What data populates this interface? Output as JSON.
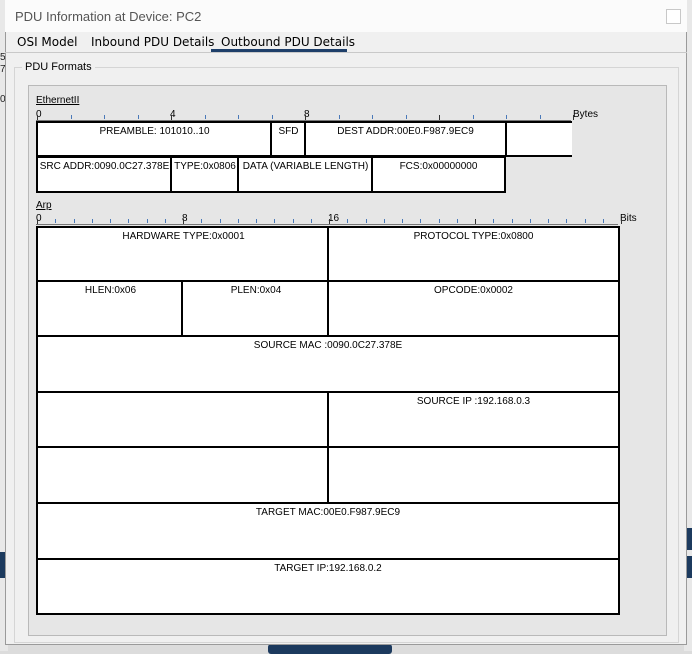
{
  "window": {
    "title": "PDU Information at Device: PC2"
  },
  "tabs": [
    {
      "label": "OSI Model"
    },
    {
      "label": "Inbound PDU Details"
    },
    {
      "label": "Outbound PDU Details"
    }
  ],
  "group": {
    "legend": "PDU Formats"
  },
  "background": {
    "edge_marks": [
      "5.",
      "7",
      "0"
    ]
  },
  "ethernet": {
    "label": "EthernetII",
    "ruler_numbers": [
      "0",
      "4",
      "8"
    ],
    "unit": "Bytes",
    "fields": {
      "preamble": "PREAMBLE: 101010..10",
      "sfd": "SFD",
      "dest": "DEST ADDR:00E0.F987.9EC9",
      "extra": "",
      "src": "SRC ADDR:0090.0C27.378E",
      "type": "TYPE:0x0806",
      "data": "DATA (VARIABLE LENGTH)",
      "fcs": "FCS:0x00000000"
    }
  },
  "arp": {
    "label": "Arp",
    "ruler_numbers": [
      "0",
      "8",
      "16"
    ],
    "unit": "Bits",
    "fields": {
      "hw_type": "HARDWARE TYPE:0x0001",
      "proto_type": "PROTOCOL TYPE:0x0800",
      "hlen": "HLEN:0x06",
      "plen": "PLEN:0x04",
      "opcode": "OPCODE:0x0002",
      "src_mac": "SOURCE MAC :0090.0C27.378E",
      "src_ip": "SOURCE IP :192.168.0.3",
      "target_mac": "TARGET MAC:00E0.F987.9EC9",
      "target_ip": "TARGET IP:192.168.0.2"
    }
  },
  "colors": {
    "tab_underline": "#1e3f6a",
    "tick": "#4a79b8"
  }
}
